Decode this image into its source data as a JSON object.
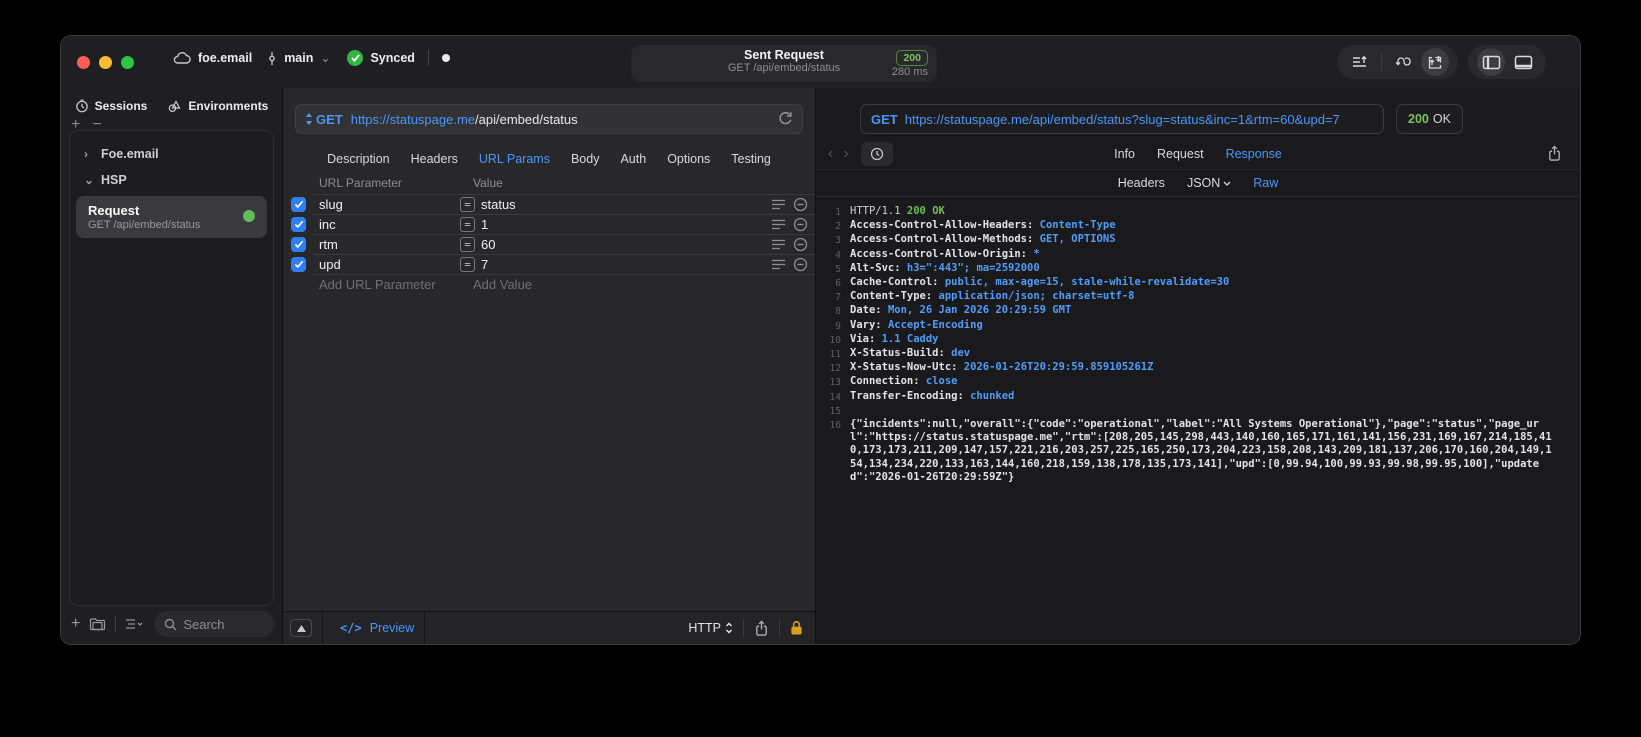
{
  "titlebar": {
    "project": "foe.email",
    "branch": "main",
    "sync_status": "Synced",
    "center": {
      "title": "Sent Request",
      "subtitle": "GET /api/embed/status",
      "status_code": "200",
      "duration": "280 ms"
    }
  },
  "sidebar": {
    "tabs": [
      {
        "label": "Sessions"
      },
      {
        "label": "Environments"
      }
    ],
    "tree": [
      {
        "label": "Foe.email"
      },
      {
        "label": "HSP"
      }
    ],
    "request_item": {
      "title": "Request",
      "subtitle": "GET /api/embed/status"
    },
    "search_placeholder": "Search"
  },
  "request_pane": {
    "method": "GET",
    "url_host": "https://statuspage.me",
    "url_path": "/api/embed/status",
    "tabs": [
      "Description",
      "Headers",
      "URL Params",
      "Body",
      "Auth",
      "Options",
      "Testing"
    ],
    "active_tab": "URL Params",
    "table": {
      "col_param": "URL Parameter",
      "col_value": "Value",
      "rows": [
        {
          "name": "slug",
          "value": "status"
        },
        {
          "name": "inc",
          "value": "1"
        },
        {
          "name": "rtm",
          "value": "60"
        },
        {
          "name": "upd",
          "value": "7"
        }
      ],
      "add_param": "Add URL Parameter",
      "add_value": "Add Value"
    },
    "footer": {
      "preview": "Preview",
      "protocol": "HTTP"
    }
  },
  "response_pane": {
    "method": "GET",
    "url": "https://statuspage.me/api/embed/status?slug=status&inc=1&rtm=60&upd=7",
    "status_code": "200",
    "status_text": "OK",
    "tabs": [
      "Info",
      "Request",
      "Response"
    ],
    "active_tab": "Response",
    "subtabs": [
      "Headers",
      "JSON",
      "Raw"
    ],
    "active_subtab": "Raw",
    "lines": [
      {
        "num": "1",
        "name": "HTTP/1.1 ",
        "value": "200 OK"
      },
      {
        "num": "2",
        "name": "Access-Control-Allow-Headers: ",
        "value": "Content-Type"
      },
      {
        "num": "3",
        "name": "Access-Control-Allow-Methods: ",
        "value": "GET, OPTIONS"
      },
      {
        "num": "4",
        "name": "Access-Control-Allow-Origin: ",
        "value": "*"
      },
      {
        "num": "5",
        "name": "Alt-Svc: ",
        "value": "h3=\":443\"; ma=2592000"
      },
      {
        "num": "6",
        "name": "Cache-Control: ",
        "value": "public, max-age=15, stale-while-revalidate=30"
      },
      {
        "num": "7",
        "name": "Content-Type: ",
        "value": "application/json; charset=utf-8"
      },
      {
        "num": "8",
        "name": "Date: ",
        "value": "Mon, 26 Jan 2026 20:29:59 GMT"
      },
      {
        "num": "9",
        "name": "Vary: ",
        "value": "Accept-Encoding"
      },
      {
        "num": "10",
        "name": "Via: ",
        "value": "1.1 Caddy"
      },
      {
        "num": "11",
        "name": "X-Status-Build: ",
        "value": "dev"
      },
      {
        "num": "12",
        "name": "X-Status-Now-Utc: ",
        "value": "2026-01-26T20:29:59.859105261Z"
      },
      {
        "num": "13",
        "name": "Connection: ",
        "value": "close"
      },
      {
        "num": "14",
        "name": "Transfer-Encoding: ",
        "value": "chunked"
      }
    ],
    "empty_line_num": "15",
    "body_line_num": "16",
    "body": "{\"incidents\":null,\"overall\":{\"code\":\"operational\",\"label\":\"All Systems Operational\"},\"page\":\"status\",\"page_url\":\"https://status.statuspage.me\",\"rtm\":[208,205,145,298,443,140,160,165,171,161,141,156,231,169,167,214,185,410,173,173,211,209,147,157,221,216,203,257,225,165,250,173,204,223,158,208,143,209,181,137,206,170,160,204,149,154,134,234,220,133,163,144,160,218,159,138,178,135,173,141],\"upd\":[0,99.94,100,99.93,99.98,99.95,100],\"updated\":\"2026-01-26T20:29:59Z\"}"
  },
  "icons": {
    "preview_glyph": "</>",
    "eq_glyph": "=",
    "plus_glyph": "+",
    "minus_glyph": "−",
    "chevron_right_glyph": "›",
    "chevron_down_glyph": "⌄",
    "back_glyph": "‹",
    "forward_glyph": "›"
  },
  "colors": {
    "accent_blue": "#4896f8",
    "status_green": "#6fbf4f",
    "lock_gold": "#d7a31c"
  }
}
